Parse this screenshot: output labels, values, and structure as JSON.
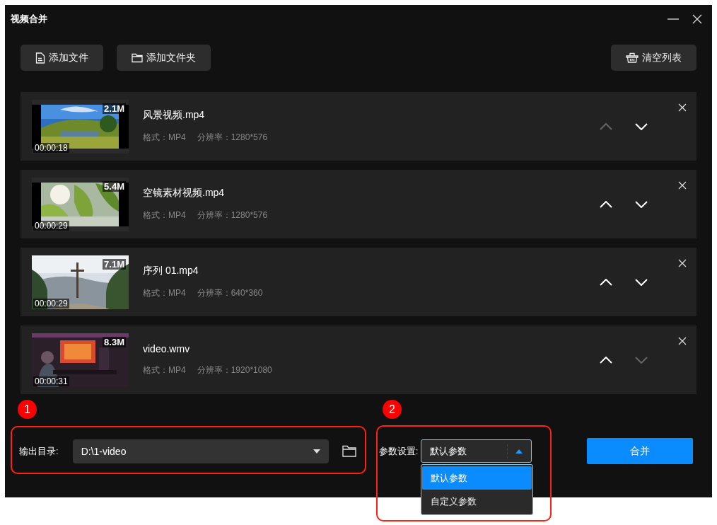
{
  "window": {
    "title": "视频合并"
  },
  "toolbar": [
    {
      "label": "添加文件"
    },
    {
      "label": "添加文件夹"
    },
    {
      "label": "清空列表"
    }
  ],
  "files": [
    {
      "name": "风景视频.mp4",
      "size": "2.1M",
      "duration": "00:00:18",
      "format": "格式：MP4",
      "resolution": "分辨率：1280*576",
      "up_disabled": true,
      "down_disabled": false
    },
    {
      "name": "空镜素材视频.mp4",
      "size": "5.4M",
      "duration": "00:00:29",
      "format": "格式：MP4",
      "resolution": "分辨率：1280*576",
      "up_disabled": false,
      "down_disabled": false
    },
    {
      "name": "序列 01.mp4",
      "size": "7.1M",
      "duration": "00:00:29",
      "format": "格式：MP4",
      "resolution": "分辨率：640*360",
      "up_disabled": false,
      "down_disabled": false
    },
    {
      "name": "video.wmv",
      "size": "8.3M",
      "duration": "00:00:31",
      "format": "格式：MP4",
      "resolution": "分辨率：1920*1080",
      "up_disabled": false,
      "down_disabled": true
    }
  ],
  "output": {
    "label": "输出目录:",
    "value": "D:\\1-video"
  },
  "params": {
    "label": "参数设置:",
    "value": "默认参数",
    "expanded": true,
    "options": [
      {
        "label": "默认参数",
        "selected": true
      },
      {
        "label": "自定义参数",
        "selected": false
      }
    ]
  },
  "merge_button": "合并",
  "annotations": [
    {
      "number": "1"
    },
    {
      "number": "2"
    }
  ]
}
